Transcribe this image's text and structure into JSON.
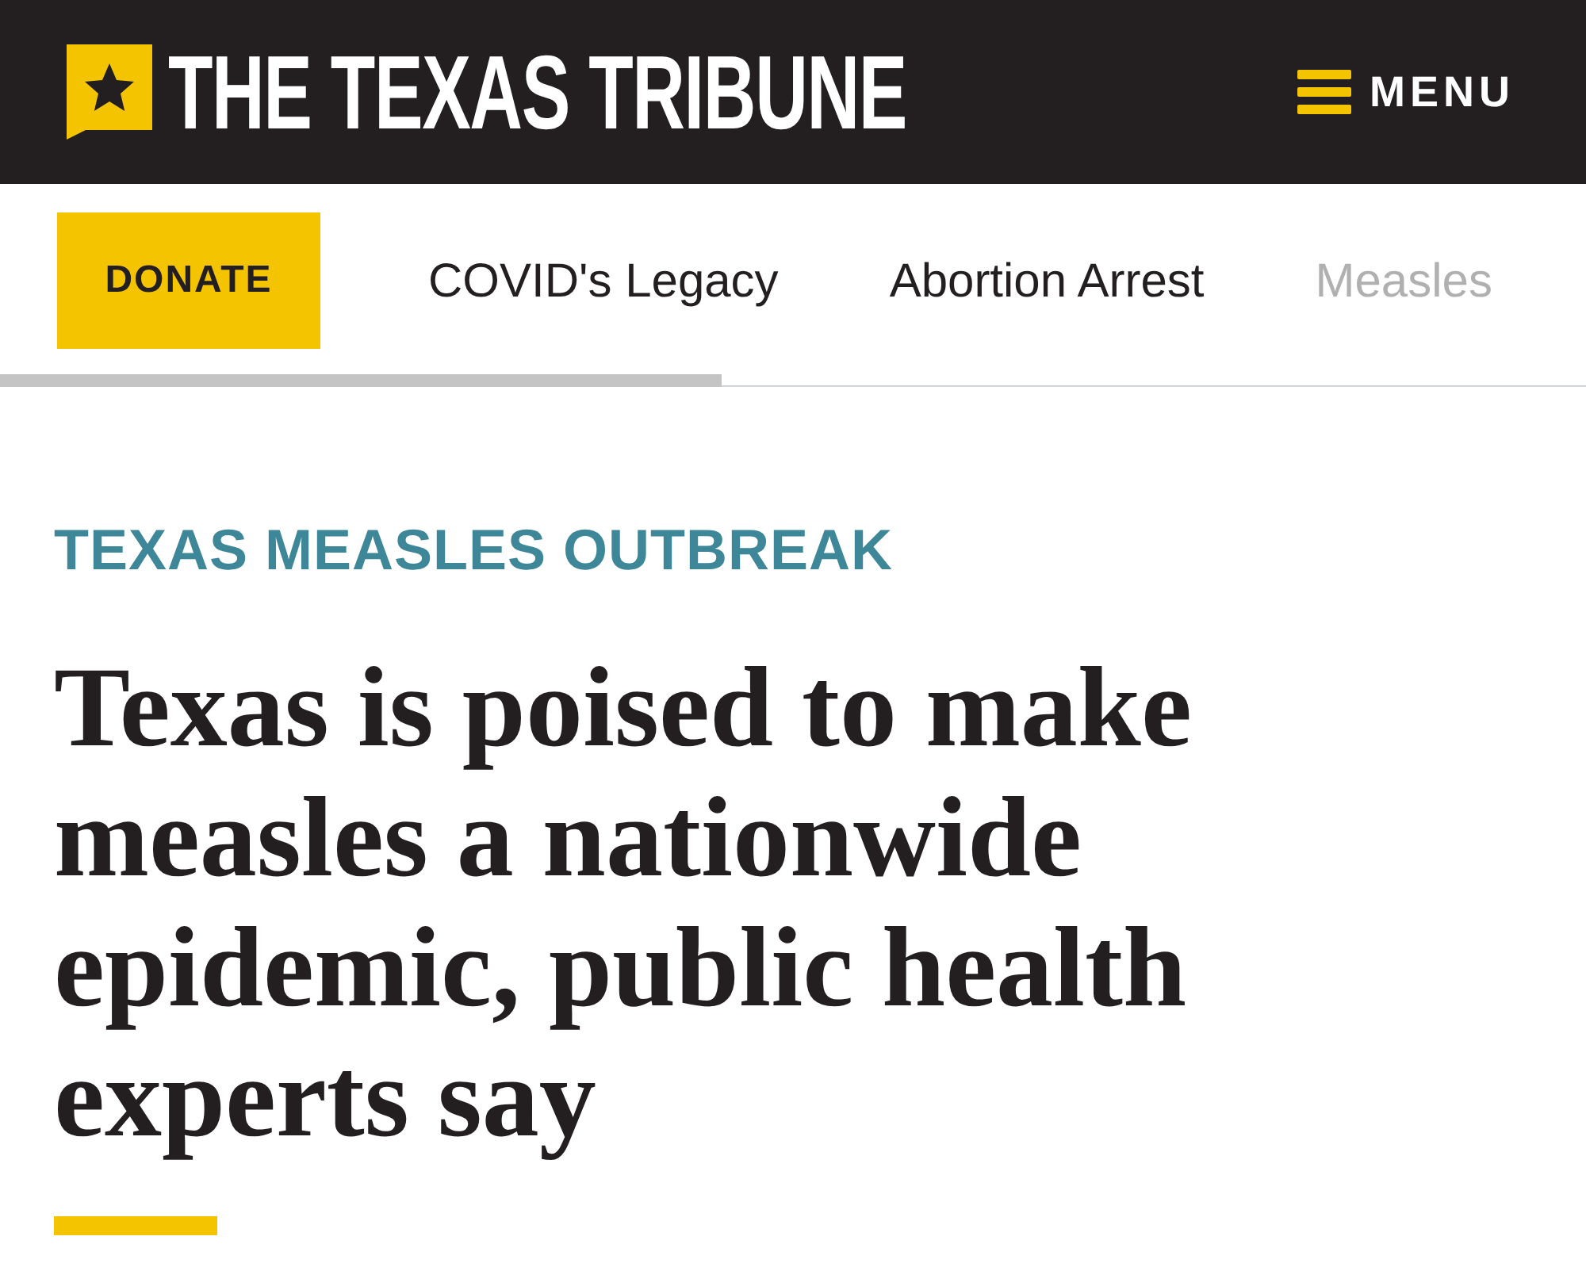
{
  "header": {
    "logo_text": "THE TEXAS TRIBUNE",
    "menu_label": "MENU"
  },
  "nav": {
    "donate": "DONATE",
    "links": [
      {
        "label": "COVID's Legacy",
        "faded": false
      },
      {
        "label": "Abortion Arrest",
        "faded": false
      },
      {
        "label": "Measles",
        "faded": true
      }
    ]
  },
  "article": {
    "kicker": "TEXAS MEASLES OUTBREAK",
    "headline": "Texas is poised to make measles a nationwide epidemic, public health experts say"
  }
}
